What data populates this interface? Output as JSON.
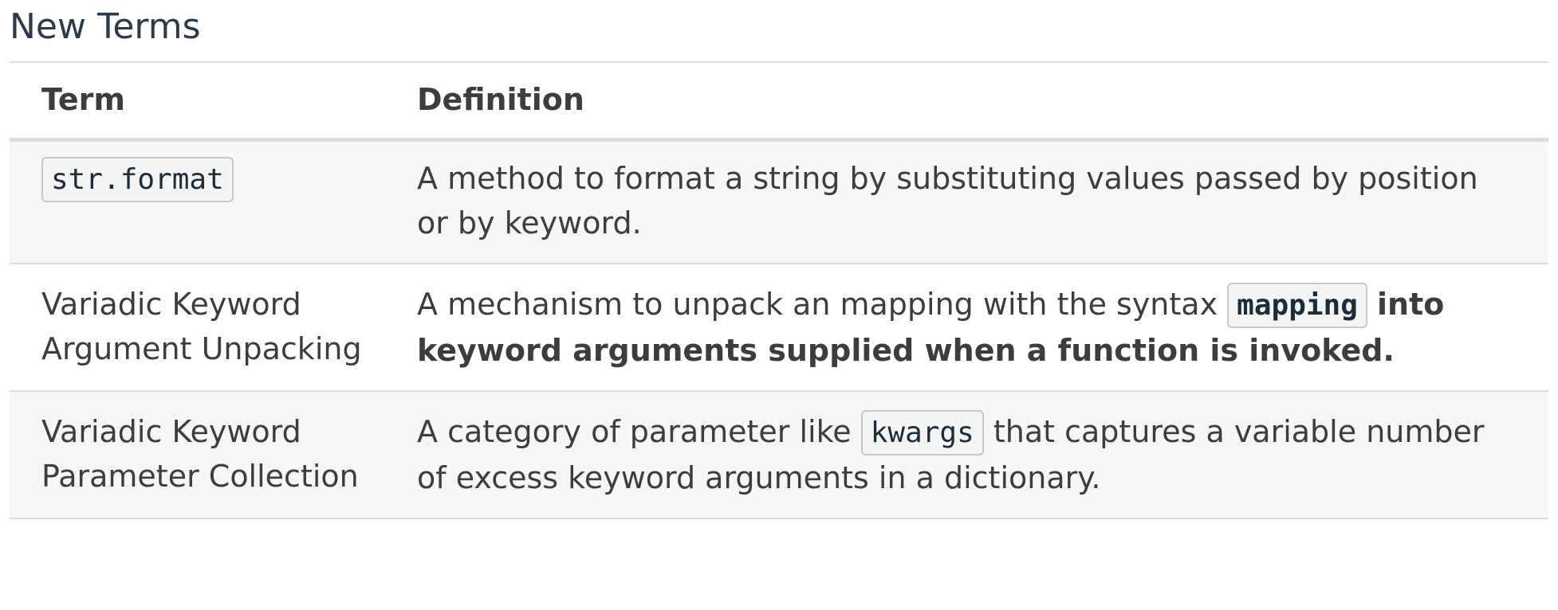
{
  "section": {
    "title": "New Terms"
  },
  "table": {
    "headers": {
      "term": "Term",
      "definition": "Definition"
    },
    "rows": [
      {
        "term_code": "str.format",
        "definition": "A method to format a string by substituting values passed by position or by keyword."
      },
      {
        "term": "Variadic Keyword Argument Unpacking",
        "definition_before": "A mechanism to unpack an mapping with the syntax",
        "definition_code": "mapping",
        "definition_after": "into keyword arguments supplied when a function is invoked."
      },
      {
        "term": "Variadic Keyword Parameter Collection",
        "definition_before": "A category of parameter like",
        "definition_code": "kwargs",
        "definition_after": "that captures a variable number of excess keyword arguments in a dictionary."
      }
    ]
  }
}
